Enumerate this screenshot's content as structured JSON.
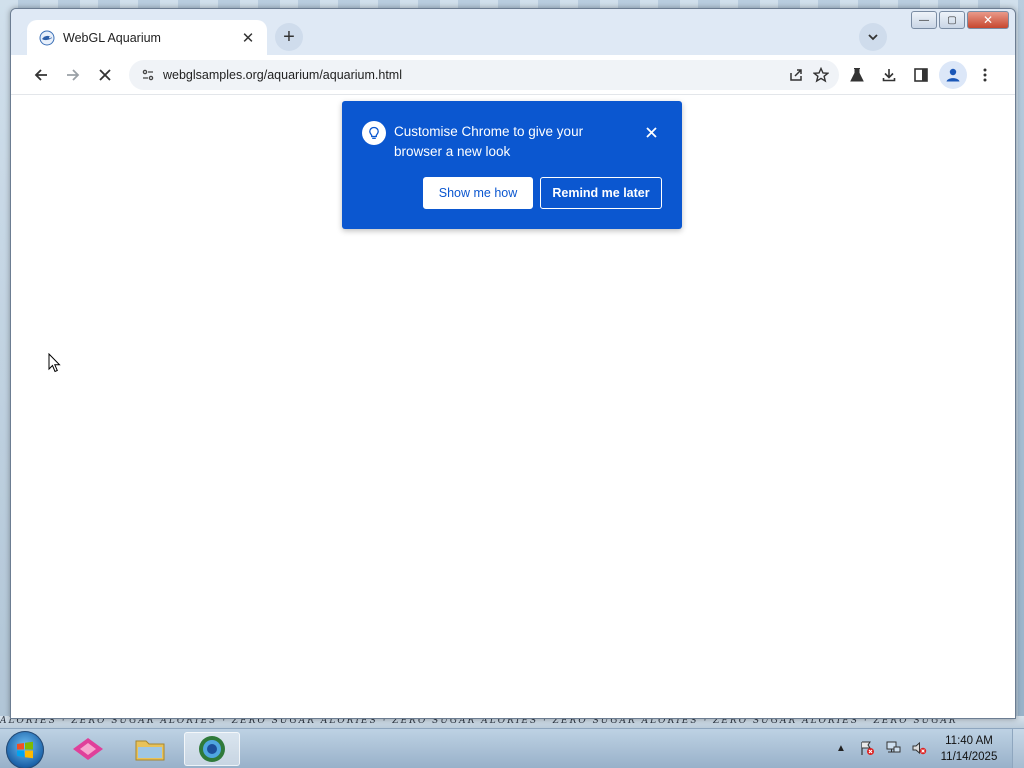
{
  "browser": {
    "tab": {
      "title": "WebGL Aquarium",
      "close_symbol": "✕",
      "favicon": "aquarium-favicon"
    },
    "new_tab_symbol": "+",
    "window_controls": {
      "minimize": "—",
      "maximize": "▢",
      "close": "✕"
    },
    "toolbar": {
      "url": "webglsamples.org/aquarium/aquarium.html",
      "loading": true
    }
  },
  "promo": {
    "message": "Customise Chrome to give your browser a new look",
    "primary_button": "Show me how",
    "secondary_button": "Remind me later",
    "close_symbol": "✕"
  },
  "taskbar": {
    "clock": {
      "time": "11:40 AM",
      "date": "11/14/2025"
    },
    "tray_arrow": "▲"
  },
  "wallpaper": {
    "banner": "ALORIES · ZERO SUGAR ALORIES · ZERO SUGAR ALORIES · ZERO SUGAR ALORIES · ZERO SUGAR ALORIES · ZERO SUGAR ALORIES · ZERO SUGAR"
  },
  "colors": {
    "promo_bg": "#0b57d0",
    "accent": "#0b57d0"
  }
}
